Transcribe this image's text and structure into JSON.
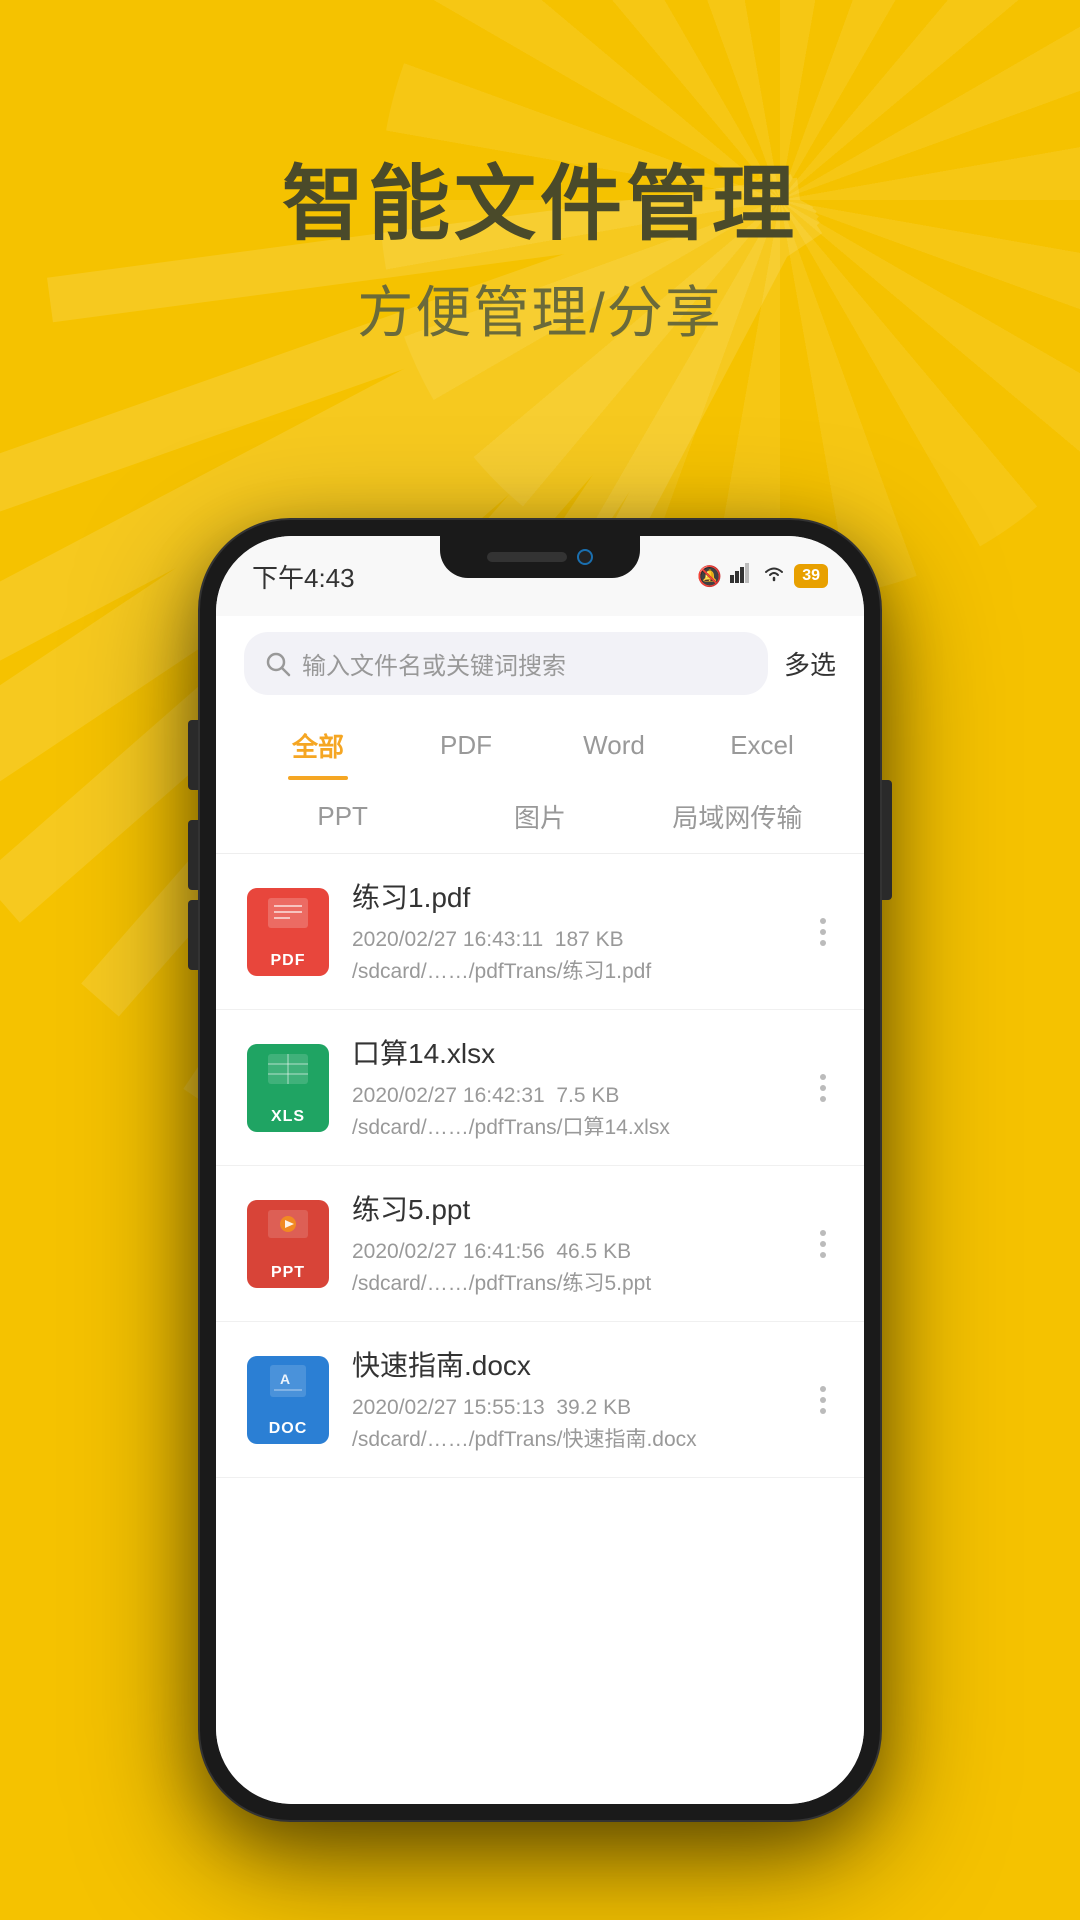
{
  "background_color": "#F5C200",
  "header": {
    "main_title": "智能文件管理",
    "sub_title": "方便管理/分享"
  },
  "phone": {
    "status_bar": {
      "time": "下午4:43",
      "bell_icon": "🔕",
      "signal": "📶",
      "wifi": "WiFi",
      "battery": "39"
    },
    "search": {
      "placeholder": "输入文件名或关键词搜索",
      "multi_select": "多选"
    },
    "tabs_row1": [
      {
        "label": "全部",
        "active": true
      },
      {
        "label": "PDF",
        "active": false
      },
      {
        "label": "Word",
        "active": false
      },
      {
        "label": "Excel",
        "active": false
      }
    ],
    "tabs_row2": [
      {
        "label": "PPT"
      },
      {
        "label": "图片"
      },
      {
        "label": "局域网传输"
      }
    ],
    "files": [
      {
        "name": "练习1.pdf",
        "type": "pdf",
        "date": "2020/02/27 16:43:11",
        "size": "187 KB",
        "path": "/sdcard/……/pdfTrans/练习1.pdf"
      },
      {
        "name": "口算14.xlsx",
        "type": "xls",
        "date": "2020/02/27 16:42:31",
        "size": "7.5 KB",
        "path": "/sdcard/……/pdfTrans/口算14.xlsx"
      },
      {
        "name": "练习5.ppt",
        "type": "ppt",
        "date": "2020/02/27 16:41:56",
        "size": "46.5 KB",
        "path": "/sdcard/……/pdfTrans/练习5.ppt"
      },
      {
        "name": "快速指南.docx",
        "type": "doc",
        "date": "2020/02/27 15:55:13",
        "size": "39.2 KB",
        "path": "/sdcard/……/pdfTrans/快速指南.docx"
      }
    ]
  }
}
